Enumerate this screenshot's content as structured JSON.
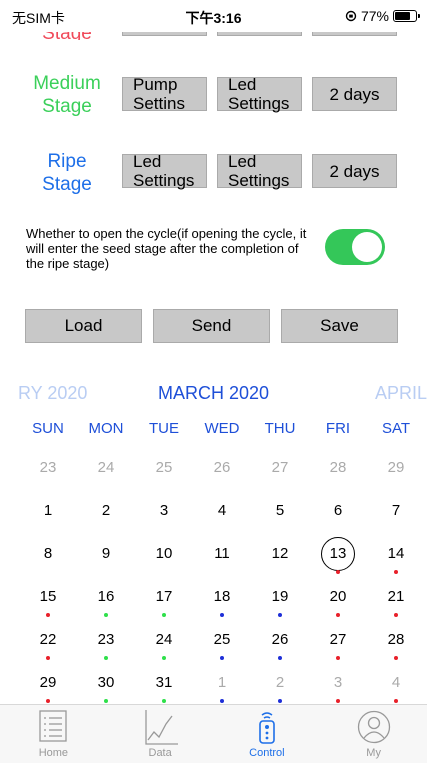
{
  "status_bar": {
    "carrier": "无SIM卡",
    "time": "下午3:16",
    "battery": "77%",
    "battery_level": 0.77
  },
  "stages": {
    "seed": {
      "label": "Stage"
    },
    "medium": {
      "label_line1": "Medium",
      "label_line2": "Stage",
      "btn1_line1": "Pump",
      "btn1_line2": "Settins",
      "btn2_line1": "Led",
      "btn2_line2": "Settings",
      "days": "2 days"
    },
    "ripe": {
      "label_line1": "Ripe",
      "label_line2": "Stage",
      "btn1_line1": "Led",
      "btn1_line2": "Settings",
      "btn2_line1": "Led",
      "btn2_line2": "Settings",
      "days": "2 days"
    }
  },
  "cycle": {
    "text": "Whether to open the cycle(if opening the cycle, it will enter the seed stage after the completion of the ripe stage)",
    "enabled": true
  },
  "actions": {
    "load": "Load",
    "send": "Send",
    "save": "Save"
  },
  "calendar": {
    "prev_month": "RY 2020",
    "current_month": "MARCH 2020",
    "next_month": "APRIL",
    "weekdays": [
      "SUN",
      "MON",
      "TUE",
      "WED",
      "THU",
      "FRI",
      "SAT"
    ],
    "colors": {
      "red": "#e8202a",
      "green": "#2ee04a",
      "blue": "#1e2fd8"
    },
    "weeks": [
      [
        {
          "d": "23",
          "o": 1
        },
        {
          "d": "24",
          "o": 1
        },
        {
          "d": "25",
          "o": 1
        },
        {
          "d": "26",
          "o": 1
        },
        {
          "d": "27",
          "o": 1
        },
        {
          "d": "28",
          "o": 1
        },
        {
          "d": "29",
          "o": 1
        }
      ],
      [
        {
          "d": "1"
        },
        {
          "d": "2"
        },
        {
          "d": "3"
        },
        {
          "d": "4"
        },
        {
          "d": "5"
        },
        {
          "d": "6"
        },
        {
          "d": "7"
        }
      ],
      [
        {
          "d": "8"
        },
        {
          "d": "9"
        },
        {
          "d": "10"
        },
        {
          "d": "11"
        },
        {
          "d": "12"
        },
        {
          "d": "13",
          "t": 1,
          "dot": "red"
        },
        {
          "d": "14",
          "dot": "red"
        }
      ],
      [
        {
          "d": "15",
          "dot": "red"
        },
        {
          "d": "16",
          "dot": "green"
        },
        {
          "d": "17",
          "dot": "green"
        },
        {
          "d": "18",
          "dot": "blue"
        },
        {
          "d": "19",
          "dot": "blue"
        },
        {
          "d": "20",
          "dot": "red"
        },
        {
          "d": "21",
          "dot": "red"
        }
      ],
      [
        {
          "d": "22",
          "dot": "red"
        },
        {
          "d": "23",
          "dot": "green"
        },
        {
          "d": "24",
          "dot": "green"
        },
        {
          "d": "25",
          "dot": "blue"
        },
        {
          "d": "26",
          "dot": "blue"
        },
        {
          "d": "27",
          "dot": "red"
        },
        {
          "d": "28",
          "dot": "red"
        }
      ],
      [
        {
          "d": "29",
          "dot": "red"
        },
        {
          "d": "30",
          "dot": "green"
        },
        {
          "d": "31",
          "dot": "green"
        },
        {
          "d": "1",
          "o": 1,
          "dot": "blue"
        },
        {
          "d": "2",
          "o": 1,
          "dot": "blue"
        },
        {
          "d": "3",
          "o": 1,
          "dot": "red"
        },
        {
          "d": "4",
          "o": 1,
          "dot": "red"
        }
      ]
    ]
  },
  "tabs": [
    {
      "label": "Home",
      "icon": "list-icon"
    },
    {
      "label": "Data",
      "icon": "chart-icon"
    },
    {
      "label": "Control",
      "icon": "remote-control-icon",
      "active": true
    },
    {
      "label": "My",
      "icon": "user-icon"
    }
  ]
}
